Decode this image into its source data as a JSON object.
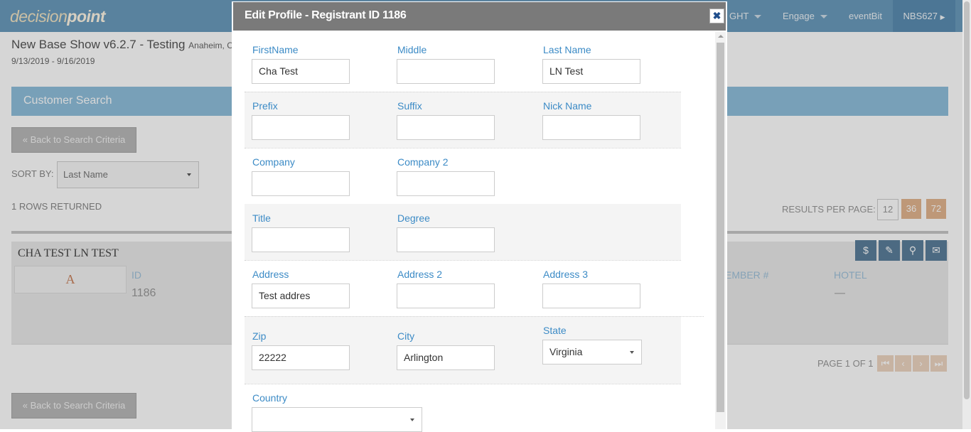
{
  "app": {
    "logo_light": "decision",
    "logo_bold": "point",
    "nav": {
      "item1": "GHT",
      "item2": "Engage",
      "item3": "eventBit",
      "user": "NBS627"
    }
  },
  "show": {
    "title": "New Base Show v6.2.7 - Testing",
    "location": "Anaheim, CA",
    "dates": "9/13/2019 - 9/16/2019"
  },
  "search": {
    "section_title": "Customer Search",
    "back_button": "« Back to Search Criteria",
    "sort_by_label": "SORT BY:",
    "sort_by_value": "Last Name",
    "rows_returned": "1 ROWS RETURNED",
    "results_per_page_label": "RESULTS PER PAGE:",
    "rpp_options": [
      "12",
      "36",
      "72"
    ]
  },
  "result": {
    "name": "CHA TEST LN TEST",
    "avatar_letter": "A",
    "id_label": "ID",
    "id_value": "1186",
    "member_label": "EMBER #",
    "hotel_label": "HOTEL",
    "hotel_value": "—",
    "actions": {
      "dollar": "$",
      "edit": "✎",
      "search": "⚲",
      "mail": "✉"
    }
  },
  "pagination": {
    "label": "PAGE 1 OF 1",
    "first": "⏮",
    "prev": "‹",
    "next": "›",
    "last": "⏭"
  },
  "modal": {
    "title": "Edit Profile - Registrant ID 1186",
    "close": "✖",
    "fields": {
      "first_name": {
        "label": "FirstName",
        "value": "Cha Test"
      },
      "middle": {
        "label": "Middle",
        "value": ""
      },
      "last_name": {
        "label": "Last Name",
        "value": "LN Test"
      },
      "prefix": {
        "label": "Prefix",
        "value": ""
      },
      "suffix": {
        "label": "Suffix",
        "value": ""
      },
      "nick_name": {
        "label": "Nick Name",
        "value": ""
      },
      "company": {
        "label": "Company",
        "value": ""
      },
      "company2": {
        "label": "Company 2",
        "value": ""
      },
      "title": {
        "label": "Title",
        "value": ""
      },
      "degree": {
        "label": "Degree",
        "value": ""
      },
      "address": {
        "label": "Address",
        "value": "Test addres"
      },
      "address2": {
        "label": "Address 2",
        "value": ""
      },
      "address3": {
        "label": "Address 3",
        "value": ""
      },
      "zip": {
        "label": "Zip",
        "value": "22222"
      },
      "city": {
        "label": "City",
        "value": "Arlington"
      },
      "state": {
        "label": "State",
        "value": "Virginia"
      },
      "country": {
        "label": "Country",
        "value": ""
      }
    }
  }
}
